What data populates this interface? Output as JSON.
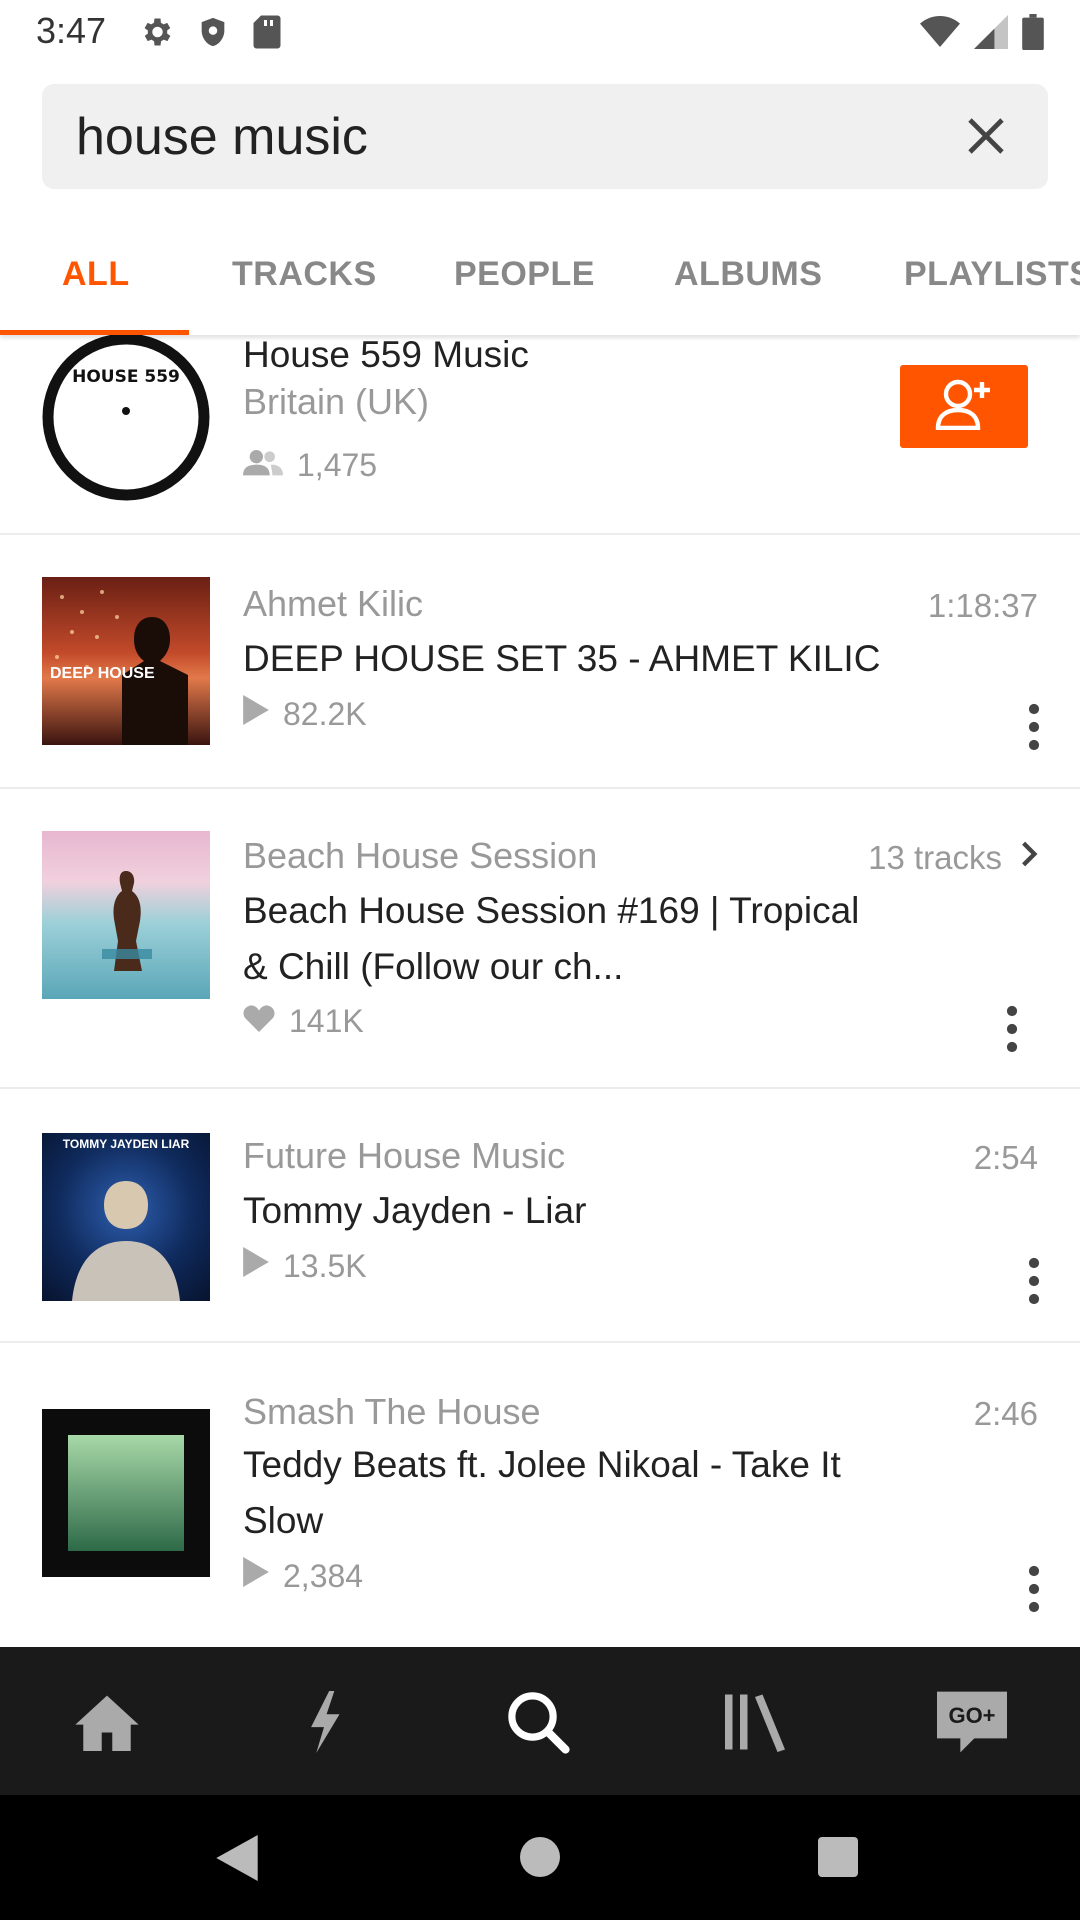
{
  "status_bar": {
    "time": "3:47",
    "left_icons": [
      "gear-icon",
      "shield-icon",
      "sd-card-icon"
    ],
    "right_icons": [
      "wifi-icon",
      "signal-icon",
      "battery-icon"
    ]
  },
  "search": {
    "value": "house music",
    "clear_icon": "close-icon"
  },
  "tabs": [
    {
      "label": "ALL",
      "active": true
    },
    {
      "label": "TRACKS",
      "active": false
    },
    {
      "label": "PEOPLE",
      "active": false
    },
    {
      "label": "ALBUMS",
      "active": false
    },
    {
      "label": "PLAYLISTS",
      "active": false
    }
  ],
  "results": [
    {
      "type": "user",
      "title": "House 559 Music",
      "subtitle": "Britain (UK)",
      "meta_icon": "followers-icon",
      "meta": "1,475",
      "thumb_text": "HOUSE 559",
      "action": "follow-button"
    },
    {
      "type": "track",
      "subtitle": "Ahmet Kilic",
      "title": "DEEP HOUSE SET 35 - AHMET KILIC",
      "duration": "1:18:37",
      "meta_icon": "play-icon",
      "meta": "82.2K",
      "thumb_text": "DEEP HOUSE"
    },
    {
      "type": "playlist",
      "subtitle": "Beach House Session",
      "title": "Beach House Session #169 | Tropical & Chill (Follow our ch...",
      "tracks": "13 tracks",
      "meta_icon": "heart-icon",
      "meta": "141K"
    },
    {
      "type": "track",
      "subtitle": "Future House Music",
      "title": "Tommy Jayden - Liar",
      "duration": "2:54",
      "meta_icon": "play-icon",
      "meta": "13.5K",
      "thumb_text": "TOMMY JAYDEN LIAR"
    },
    {
      "type": "track",
      "subtitle": "Smash The House",
      "title": "Teddy Beats ft. Jolee Nikoal - Take It Slow",
      "duration": "2:46",
      "meta_icon": "play-icon",
      "meta": "2,384"
    }
  ],
  "bottom_nav": [
    {
      "name": "home-icon",
      "active": false
    },
    {
      "name": "stream-icon",
      "active": false
    },
    {
      "name": "search-icon",
      "active": true
    },
    {
      "name": "library-icon",
      "active": false
    },
    {
      "name": "go-plus-icon",
      "active": false,
      "label": "GO+"
    }
  ],
  "system_nav": [
    "back-icon",
    "home-circle-icon",
    "recents-icon"
  ],
  "colors": {
    "accent": "#ff5500",
    "nav_bg": "#1a1a1a",
    "muted_text": "#999999"
  }
}
